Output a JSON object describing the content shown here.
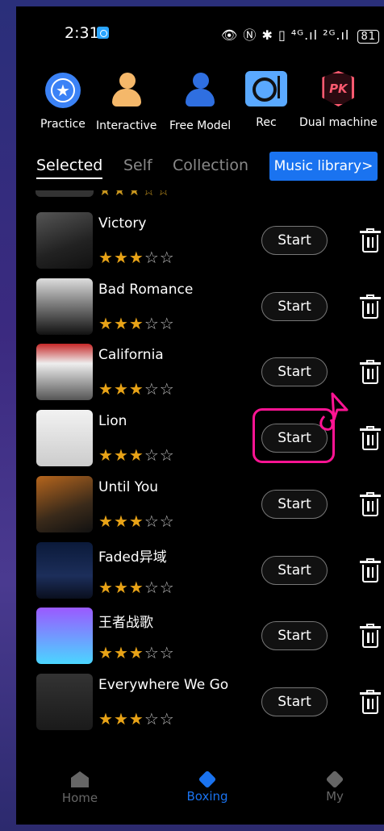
{
  "status_bar": {
    "time": "2:31",
    "icons": "👁 Ⓝ ✱ ▯ ⁴ᴳ.ıl ²ᴳ.ıl",
    "battery": "81"
  },
  "modes": [
    {
      "label": "Practice",
      "icon": "star-circle-icon"
    },
    {
      "label": "Interactive",
      "icon": "person-orange-icon"
    },
    {
      "label": "Free Model",
      "icon": "person-blue-icon"
    },
    {
      "label": "Rec",
      "icon": "record-icon"
    },
    {
      "label": "Dual machine",
      "icon": "pk-shield-icon"
    }
  ],
  "tabs": [
    {
      "label": "Selected",
      "active": true
    },
    {
      "label": "Self",
      "active": false
    },
    {
      "label": "Collection",
      "active": false
    }
  ],
  "music_library_label": "Music library>",
  "start_label": "Start",
  "songs": [
    {
      "title": "Victory",
      "rating": 3,
      "max_rating": 5
    },
    {
      "title": "Bad Romance",
      "rating": 3,
      "max_rating": 5
    },
    {
      "title": "California",
      "rating": 3,
      "max_rating": 5
    },
    {
      "title": "Lion",
      "rating": 3,
      "max_rating": 5
    },
    {
      "title": "Until You",
      "rating": 3,
      "max_rating": 5
    },
    {
      "title": "Faded异域",
      "rating": 3,
      "max_rating": 5
    },
    {
      "title": "王者战歌",
      "rating": 3,
      "max_rating": 5
    },
    {
      "title": "Everywhere We Go",
      "rating": 3,
      "max_rating": 5
    }
  ],
  "bottom_nav": [
    {
      "label": "Home",
      "active": false
    },
    {
      "label": "Boxing",
      "active": true
    },
    {
      "label": "My",
      "active": false
    }
  ],
  "colors": {
    "accent": "#1a73f0",
    "star": "#e8a317",
    "highlight": "#ff1493"
  }
}
